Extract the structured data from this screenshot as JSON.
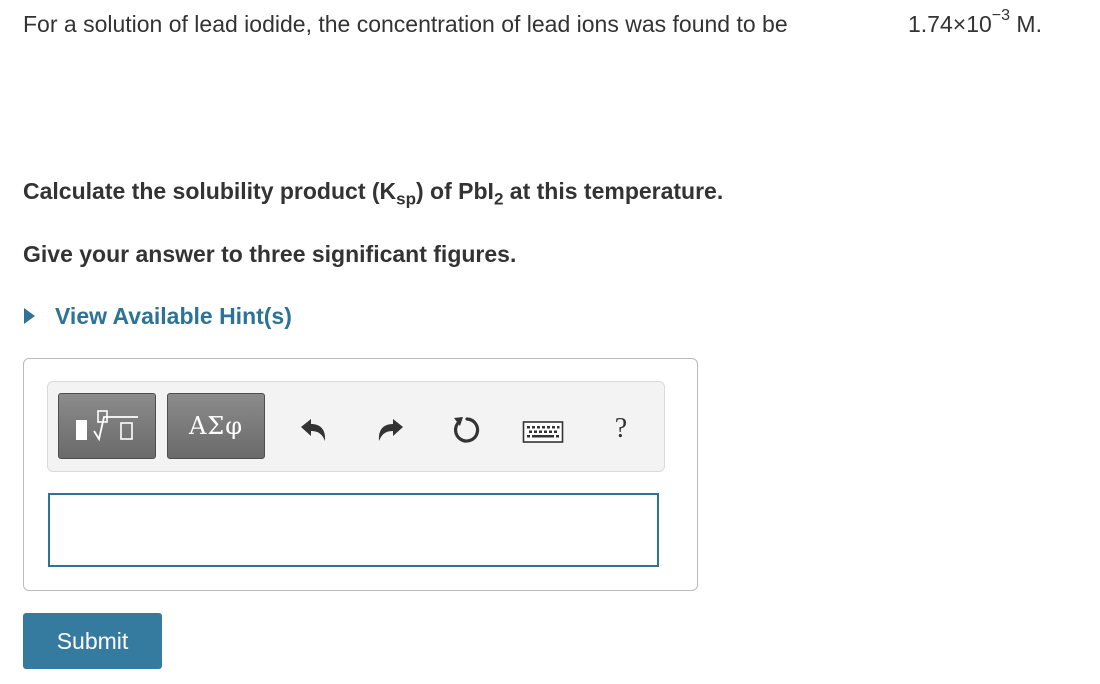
{
  "problem": {
    "statement": "For a solution of lead iodide, the concentration of lead ions was found to be",
    "concentration_base": "1.74×10",
    "concentration_exp": "−3",
    "concentration_unit": " M.",
    "question_pre": "Calculate the solubility product (K",
    "question_sub1": "sp",
    "question_mid": ") of PbI",
    "question_sub2": "2",
    "question_post": " at this temperature.",
    "instruction": "Give your answer to three significant figures."
  },
  "hint": {
    "label": "View Available Hint(s)"
  },
  "toolbar": {
    "greek_label": "ΑΣφ",
    "help_label": "?",
    "icons": [
      "templates-icon",
      "undo-icon",
      "redo-icon",
      "reset-icon",
      "keyboard-icon",
      "help-icon"
    ]
  },
  "answer": {
    "value": "",
    "placeholder": ""
  },
  "submit": {
    "label": "Submit"
  },
  "colors": {
    "accent": "#2d7397",
    "submit_bg": "#357ba0",
    "button_gray": "#7a7a7a"
  }
}
